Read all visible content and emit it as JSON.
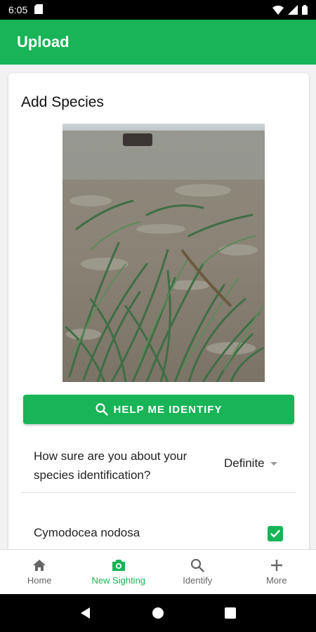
{
  "status_bar": {
    "time": "6:05"
  },
  "app_bar": {
    "title": "Upload"
  },
  "card": {
    "title": "Add Species",
    "identify_button_label": "HELP ME IDENTIFY",
    "question": "How sure are you about your species identification?",
    "certainty_value": "Definite",
    "species": [
      {
        "name": "Cymodocea nodosa",
        "checked": true
      }
    ]
  },
  "bottom_nav": [
    {
      "label": "Home",
      "icon": "home-icon",
      "active": false
    },
    {
      "label": "New Sighting",
      "icon": "camera-icon",
      "active": true
    },
    {
      "label": "Identify",
      "icon": "search-icon",
      "active": false
    },
    {
      "label": "More",
      "icon": "plus-icon",
      "active": false
    }
  ],
  "colors": {
    "accent": "#18b457"
  }
}
